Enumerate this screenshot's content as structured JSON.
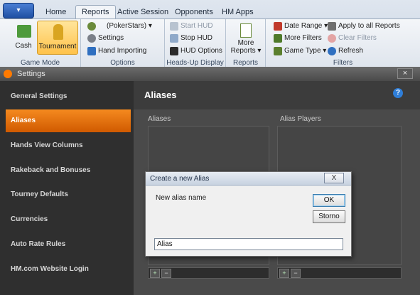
{
  "ribbon": {
    "app_button": "▾",
    "tabs": [
      "Home",
      "Reports",
      "Active Session",
      "Opponents",
      "HM Apps"
    ],
    "active_tab": "Reports",
    "groups": {
      "game_mode": {
        "label": "Game Mode",
        "cash": "Cash",
        "tournament": "Tournament"
      },
      "options": {
        "label": "Options",
        "player": "(PokerStars)",
        "settings": "Settings",
        "hand_importing": "Hand Importing"
      },
      "hud": {
        "label": "Heads-Up Display",
        "start_hud": "Start HUD",
        "stop_hud": "Stop HUD",
        "hud_options": "HUD Options"
      },
      "reports": {
        "label": "Reports",
        "more_reports": "More Reports"
      },
      "filters": {
        "label": "Filters",
        "date_range": "Date Range",
        "more_filters": "More Filters",
        "game_type": "Game Type",
        "apply_all": "Apply to all Reports",
        "clear_filters": "Clear Filters",
        "refresh": "Refresh"
      }
    }
  },
  "settings": {
    "window_title": "Settings",
    "close": "×",
    "sidebar": [
      "General Settings",
      "Aliases",
      "Hands View Columns",
      "Rakeback and Bonuses",
      "Tourney Defaults",
      "Currencies",
      "Auto Rate Rules",
      "HM.com Website Login"
    ],
    "active_item": "Aliases",
    "content": {
      "title": "Aliases",
      "help": "?",
      "aliases_label": "Aliases",
      "alias_players_label": "Alias Players",
      "add": "+",
      "remove": "−"
    }
  },
  "dialog": {
    "title": "Create a new Alias",
    "close": "X",
    "label": "New alias name",
    "ok": "OK",
    "cancel": "Storno",
    "input_value": "Alias"
  },
  "colors": {
    "accent": "#f07d10",
    "ribbon_bg": "#dfe5ed",
    "dark_bg": "#3e3e3e"
  }
}
